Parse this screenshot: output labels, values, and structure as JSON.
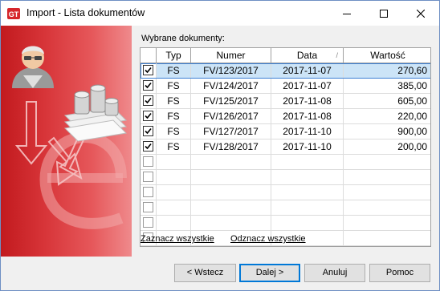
{
  "window": {
    "title": "Import - Lista dokumentów",
    "app_icon": "app-logo-icon",
    "controls": [
      "minimize-icon",
      "maximize-icon",
      "close-icon"
    ]
  },
  "colors": {
    "art_red": "#c21a1e",
    "selection": "#cce4f7",
    "accent": "#0078d7"
  },
  "list": {
    "label": "Wybrane dokumenty:",
    "columns": [
      "Typ",
      "Numer",
      "Data",
      "Wartość"
    ],
    "sort_glyph": "/",
    "rows": [
      {
        "checked": true,
        "typ": "FS",
        "numer": "FV/123/2017",
        "data": "2017-11-07",
        "wartosc": "270,60",
        "selected": true
      },
      {
        "checked": true,
        "typ": "FS",
        "numer": "FV/124/2017",
        "data": "2017-11-07",
        "wartosc": "385,00"
      },
      {
        "checked": true,
        "typ": "FS",
        "numer": "FV/125/2017",
        "data": "2017-11-08",
        "wartosc": "605,00"
      },
      {
        "checked": true,
        "typ": "FS",
        "numer": "FV/126/2017",
        "data": "2017-11-08",
        "wartosc": "220,00"
      },
      {
        "checked": true,
        "typ": "FS",
        "numer": "FV/127/2017",
        "data": "2017-11-10",
        "wartosc": "900,00"
      },
      {
        "checked": true,
        "typ": "FS",
        "numer": "FV/128/2017",
        "data": "2017-11-10",
        "wartosc": "200,00"
      },
      {
        "checked": false,
        "typ": "",
        "numer": "",
        "data": "",
        "wartosc": ""
      },
      {
        "checked": false,
        "typ": "",
        "numer": "",
        "data": "",
        "wartosc": ""
      },
      {
        "checked": false,
        "typ": "",
        "numer": "",
        "data": "",
        "wartosc": ""
      },
      {
        "checked": false,
        "typ": "",
        "numer": "",
        "data": "",
        "wartosc": ""
      },
      {
        "checked": false,
        "typ": "",
        "numer": "",
        "data": "",
        "wartosc": ""
      },
      {
        "checked": false,
        "typ": "",
        "numer": "",
        "data": "",
        "wartosc": ""
      }
    ]
  },
  "links": {
    "select_all": "Zaznacz wszystkie",
    "unselect_all": "Odznacz wszystkie"
  },
  "buttons": {
    "back": "< Wstecz",
    "next": "Dalej >",
    "cancel": "Anuluj",
    "help": "Pomoc"
  }
}
